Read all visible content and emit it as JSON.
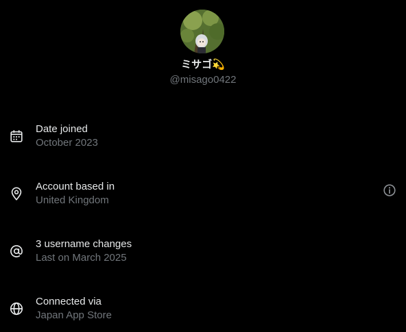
{
  "profile": {
    "display_name": "ミサゴ💫",
    "handle": "@misago0422",
    "avatar_icon": "profile-photo"
  },
  "about": {
    "items": [
      {
        "icon": "calendar-icon",
        "title": "Date joined",
        "value": "October 2023"
      },
      {
        "icon": "location-pin-icon",
        "title": "Account based in",
        "value": "United Kingdom",
        "has_info": true
      },
      {
        "icon": "at-sign-icon",
        "title": "3 username changes",
        "value": "Last on March 2025"
      },
      {
        "icon": "globe-icon",
        "title": "Connected via",
        "value": "Japan App Store"
      }
    ]
  },
  "colors": {
    "background": "#000000",
    "primary_text": "#e7e9ea",
    "secondary_text": "#71767b"
  }
}
